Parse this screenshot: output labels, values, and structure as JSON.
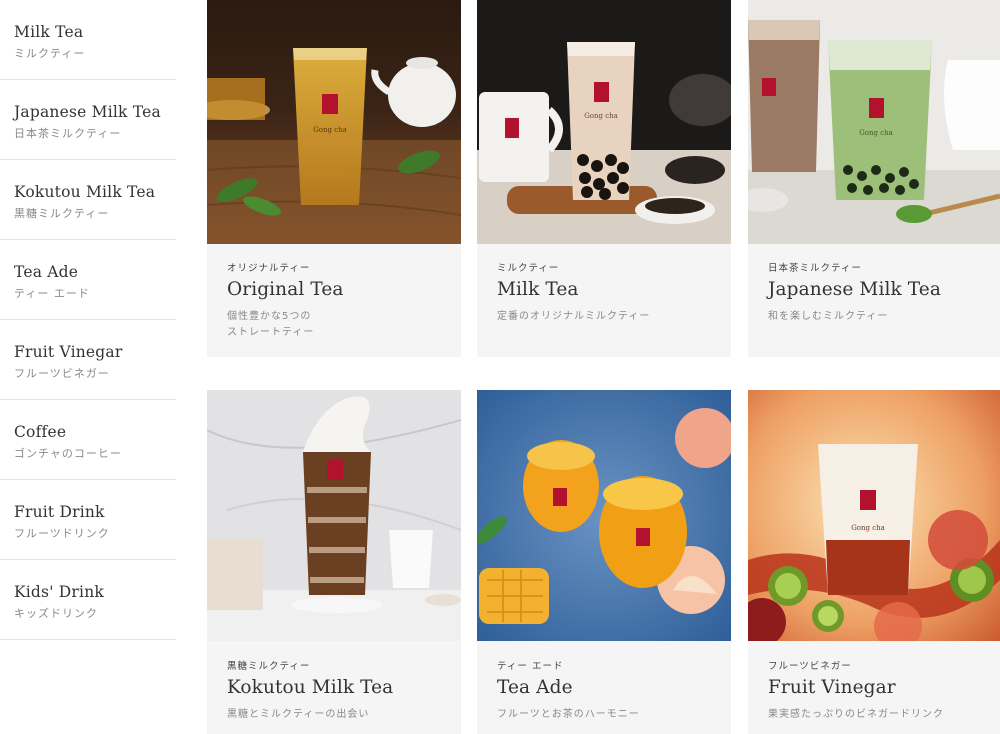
{
  "sidebar": {
    "items": [
      {
        "en": "Milk Tea",
        "ja": "ミルクティー"
      },
      {
        "en": "Japanese Milk Tea",
        "ja": "日本茶ミルクティー"
      },
      {
        "en": "Kokutou Milk Tea",
        "ja": "黒糖ミルクティー"
      },
      {
        "en": "Tea Ade",
        "ja": "ティー エード"
      },
      {
        "en": "Fruit Vinegar",
        "ja": "フルーツビネガー"
      },
      {
        "en": "Coffee",
        "ja": "ゴンチャのコーヒー"
      },
      {
        "en": "Fruit Drink",
        "ja": "フルーツドリンク"
      },
      {
        "en": "Kids' Drink",
        "ja": "キッズドリンク"
      }
    ]
  },
  "cards": [
    {
      "category": "オリジナルティー",
      "title": "Original Tea",
      "desc": [
        "個性豊かな5つの",
        "ストレートティー"
      ]
    },
    {
      "category": "ミルクティー",
      "title": "Milk Tea",
      "desc": [
        "定番のオリジナルミルクティー"
      ]
    },
    {
      "category": "日本茶ミルクティー",
      "title": "Japanese Milk Tea",
      "desc": [
        "和を楽しむミルクティー"
      ]
    },
    {
      "category": "黒糖ミルクティー",
      "title": "Kokutou Milk Tea",
      "desc": [
        "黒糖とミルクティーの出会い"
      ]
    },
    {
      "category": "ティー エード",
      "title": "Tea Ade",
      "desc": [
        "フルーツとお茶のハーモニー"
      ]
    },
    {
      "category": "フルーツビネガー",
      "title": "Fruit Vinegar",
      "desc": [
        "果実感たっぷりのビネガードリンク"
      ]
    }
  ],
  "brand": {
    "cup_logo_text": "Gong cha",
    "accent": "#b3122e"
  }
}
